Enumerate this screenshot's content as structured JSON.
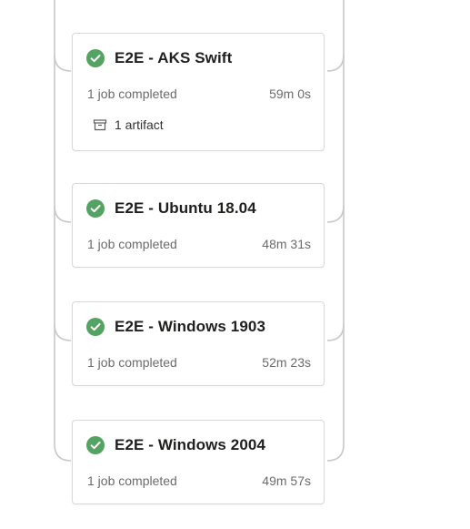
{
  "stages": [
    {
      "title": "E2E - AKS Swift",
      "status": "succeeded",
      "jobs": "1 job completed",
      "duration": "59m 0s",
      "artifact": "1 artifact"
    },
    {
      "title": "E2E - Ubuntu 18.04",
      "status": "succeeded",
      "jobs": "1 job completed",
      "duration": "48m 31s"
    },
    {
      "title": "E2E - Windows 1903",
      "status": "succeeded",
      "jobs": "1 job completed",
      "duration": "52m 23s"
    },
    {
      "title": "E2E - Windows 2004",
      "status": "succeeded",
      "jobs": "1 job completed",
      "duration": "49m 57s"
    }
  ],
  "icons": {
    "status": "check-circle-icon",
    "artifact": "artifact-box-icon"
  },
  "colors": {
    "success": "#55a362",
    "border": "#d8d8d8",
    "connector": "#c8c8c8",
    "title": "#201f1e",
    "meta": "#6b6b6b"
  }
}
